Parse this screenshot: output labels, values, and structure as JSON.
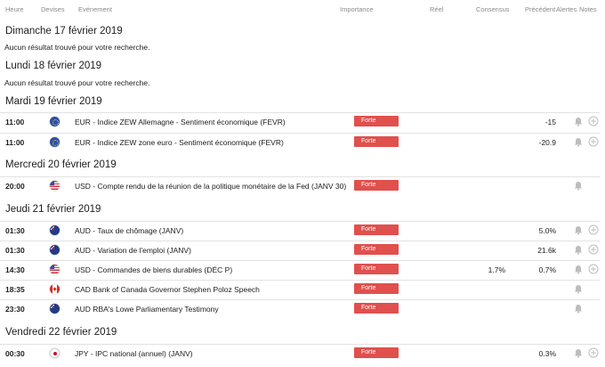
{
  "header": {
    "time": "Heure",
    "currency": "Devises",
    "event": "Evénement",
    "importance": "Importance",
    "actual": "Réel",
    "consensus": "Consensus",
    "previous": "Précédent",
    "alerts": "Alertes",
    "notes": "Notes"
  },
  "no_result_text": "Aucun résultat trouvé pour votre recherche.",
  "colors": {
    "impact_high": "#e0504d",
    "row_divider": "#e2e2e2",
    "icon_grey": "#bdbdbd"
  },
  "days": [
    {
      "title": "Dimanche 17 février 2019",
      "events": []
    },
    {
      "title": "Lundi 18 février 2019",
      "events": []
    },
    {
      "title": "Mardi 19 février 2019",
      "events": [
        {
          "time": "11:00",
          "flag": "eu-flag-icon",
          "event": "EUR - Indice ZEW Allemagne - Sentiment économique (FEVR)",
          "impact": "Forte",
          "consensus": "",
          "previous": "-15",
          "plus": true
        },
        {
          "time": "11:00",
          "flag": "eu-flag-icon",
          "event": "EUR - Indice ZEW zone euro - Sentiment économique (FEVR)",
          "impact": "Forte",
          "consensus": "",
          "previous": "-20.9",
          "plus": true
        }
      ]
    },
    {
      "title": "Mercredi 20 février 2019",
      "events": [
        {
          "time": "20:00",
          "flag": "us-flag-icon",
          "event": "USD - Compte rendu de la réunion de la politique monétaire de la Fed (JANV 30)",
          "impact": "Forte",
          "consensus": "",
          "previous": "",
          "plus": false
        }
      ]
    },
    {
      "title": "Jeudi 21 février 2019",
      "events": [
        {
          "time": "01:30",
          "flag": "au-flag-icon",
          "event": "AUD - Taux de chômage (JANV)",
          "impact": "Forte",
          "consensus": "",
          "previous": "5.0%",
          "plus": true
        },
        {
          "time": "01:30",
          "flag": "au-flag-icon",
          "event": "AUD - Variation de l'emploi (JANV)",
          "impact": "Forte",
          "consensus": "",
          "previous": "21.6k",
          "plus": true
        },
        {
          "time": "14:30",
          "flag": "us-flag-icon",
          "event": "USD - Commandes de biens durables (DÉC P)",
          "impact": "Forte",
          "consensus": "1.7%",
          "previous": "0.7%",
          "plus": true
        },
        {
          "time": "18:35",
          "flag": "ca-flag-icon",
          "event": "CAD Bank of Canada Governor Stephen Poloz Speech",
          "impact": "Forte",
          "consensus": "",
          "previous": "",
          "plus": false
        },
        {
          "time": "23:30",
          "flag": "au-flag-icon",
          "event": "AUD RBA's Lowe Parliamentary Testimony",
          "impact": "Forte",
          "consensus": "",
          "previous": "",
          "plus": false
        }
      ]
    },
    {
      "title": "Vendredi 22 février 2019",
      "events": [
        {
          "time": "00:30",
          "flag": "jp-flag-icon",
          "event": "JPY - IPC national (annuel) (JANV)",
          "impact": "Forte",
          "consensus": "",
          "previous": "0.3%",
          "plus": true
        }
      ]
    }
  ]
}
